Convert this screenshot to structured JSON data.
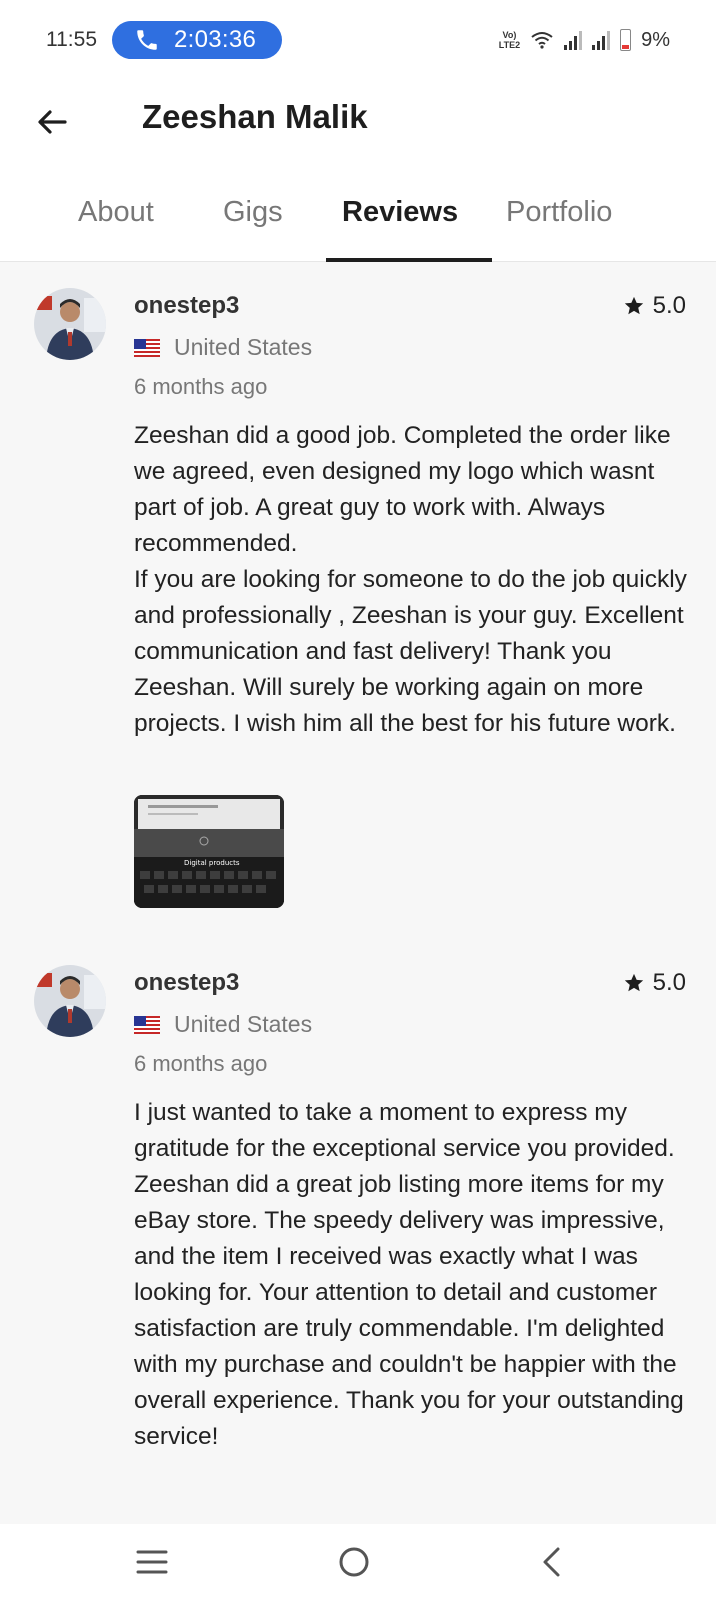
{
  "status_bar": {
    "time": "11:55",
    "call_timer": "2:03:36",
    "volte_label": "Vo)) LTE2",
    "battery": "9%"
  },
  "header": {
    "title": "Zeeshan Malik"
  },
  "tabs": [
    {
      "label": "About"
    },
    {
      "label": "Gigs"
    },
    {
      "label": "Reviews"
    },
    {
      "label": "Portfolio"
    }
  ],
  "active_tab": "Reviews",
  "reviews": [
    {
      "username": "onestep3",
      "rating": "5.0",
      "country": "United States",
      "time": "6 months ago",
      "text": "Zeeshan did a good job. Completed the order like we agreed, even designed my logo which wasnt part of job. A great guy to work with. Always recommended.\nIf you are looking for someone to do the job quickly and professionally , Zeeshan is your guy. Excellent communication and fast delivery! Thank you Zeeshan. Will surely be working again on more projects. I wish him all the best for his future work.",
      "attachment_caption": "Digital products"
    },
    {
      "username": "onestep3",
      "rating": "5.0",
      "country": "United States",
      "time": "6 months ago",
      "text": "I just wanted to take a moment to express my gratitude for the exceptional service you provided. Zeeshan did a great job listing more items for my eBay store. The speedy delivery was impressive, and the item I received was exactly what I was looking for. Your attention to detail and customer satisfaction are truly commendable. I'm delighted with my purchase and couldn't be happier with the overall experience. Thank you for your outstanding service!"
    }
  ],
  "icons": {
    "back": "arrow-left-icon",
    "star": "star-icon",
    "flag": "us-flag-icon",
    "menu": "recents-icon",
    "home": "home-icon",
    "nav_back": "chevron-left-icon"
  },
  "colors": {
    "call_pill": "#2f6fe0",
    "active_tab": "#1e1e1e",
    "inactive_tab": "#777777",
    "battery_low": "#e53935"
  }
}
